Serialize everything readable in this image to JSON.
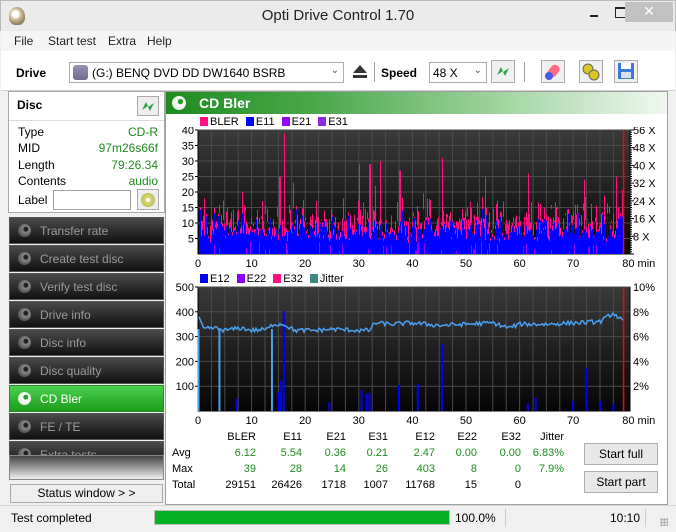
{
  "window": {
    "title": "Opti Drive Control 1.70",
    "close_glyph": "✕"
  },
  "menu": [
    "File",
    "Start test",
    "Extra",
    "Help"
  ],
  "toolbar": {
    "drive_label": "Drive",
    "drive_value": "(G:)   BENQ DVD DD DW1640 BSRB",
    "speed_label": "Speed",
    "speed_value": "48 X",
    "icons": [
      "eject-icon",
      "refresh-icon",
      "erase-icon",
      "settings-icon",
      "save-icon"
    ]
  },
  "disc": {
    "title": "Disc",
    "rows": [
      {
        "key": "Type",
        "value": "CD-R"
      },
      {
        "key": "MID",
        "value": "97m26s66f"
      },
      {
        "key": "Length",
        "value": "79:26.34"
      },
      {
        "key": "Contents",
        "value": "audio"
      }
    ],
    "label_key": "Label",
    "label_value": ""
  },
  "nav": [
    {
      "label": "Transfer rate",
      "active": false
    },
    {
      "label": "Create test disc",
      "active": false
    },
    {
      "label": "Verify test disc",
      "active": false
    },
    {
      "label": "Drive info",
      "active": false
    },
    {
      "label": "Disc info",
      "active": false
    },
    {
      "label": "Disc quality",
      "active": false
    },
    {
      "label": "CD Bler",
      "active": true
    },
    {
      "label": "FE / TE",
      "active": false
    },
    {
      "label": "Extra tests",
      "active": false
    }
  ],
  "status_window_button": "Status window > >",
  "main": {
    "title": "CD Bler",
    "colors": {
      "bler": "#ff1080",
      "e11": "#0000ff",
      "e21": "#9a00ff",
      "e31": "#8a2be2",
      "e12": "#0000ff",
      "e22": "#8a00ff",
      "e32": "#ff1080",
      "jitter": "#3a8a80",
      "jitter_line": "#4aa0f0",
      "marker": "#ff0000"
    }
  },
  "chart_data": [
    {
      "type": "bar",
      "title": "BLER / E11 / E21 / E31",
      "legend": [
        "BLER",
        "E11",
        "E21",
        "E31"
      ],
      "legend_placement": "top-left",
      "xlabel": "min",
      "x_ticks": [
        "0",
        "10",
        "20",
        "30",
        "40",
        "50",
        "60",
        "70",
        "80 min"
      ],
      "xlim": [
        0,
        80
      ],
      "y_ticks": [
        "5",
        "10",
        "15",
        "20",
        "25",
        "30",
        "35",
        "40"
      ],
      "ylim": [
        0,
        40
      ],
      "y2_ticks": [
        "8 X",
        "16 X",
        "24 X",
        "32 X",
        "40 X",
        "48 X",
        "56 X"
      ],
      "y2lim": [
        0,
        56
      ],
      "grid": true,
      "end_marker_min": 79.4,
      "series_summary": {
        "BLER": {
          "typical": 10,
          "max": 39,
          "peak_at_min": 16
        },
        "E11": {
          "typical": 8,
          "max": 28
        },
        "E21": {
          "typical": 0.4,
          "max": 14
        },
        "E31": {
          "typical": 0.2,
          "max": 26
        }
      },
      "peaks": [
        {
          "min": 1.2,
          "bler": 18
        },
        {
          "min": 8.2,
          "bler": 20
        },
        {
          "min": 12,
          "bler": 17
        },
        {
          "min": 15.2,
          "bler": 25
        },
        {
          "min": 16,
          "bler": 39
        },
        {
          "min": 17.8,
          "bler": 23
        },
        {
          "min": 22,
          "bler": 17
        },
        {
          "min": 27,
          "bler": 18
        },
        {
          "min": 30,
          "bler": 29
        },
        {
          "min": 32,
          "bler": 29
        },
        {
          "min": 33,
          "bler": 22
        },
        {
          "min": 34,
          "bler": 30
        },
        {
          "min": 37.5,
          "bler": 27
        },
        {
          "min": 45.5,
          "bler": 31
        },
        {
          "min": 53.5,
          "bler": 25
        },
        {
          "min": 61.5,
          "bler": 26
        },
        {
          "min": 72,
          "bler": 24
        },
        {
          "min": 78,
          "bler": 25
        }
      ]
    },
    {
      "type": "bar",
      "title": "E12 / E22 / E32 / Jitter",
      "legend": [
        "E12",
        "E22",
        "E32",
        "Jitter"
      ],
      "legend_placement": "top-left",
      "xlabel": "min",
      "x_ticks": [
        "0",
        "10",
        "20",
        "30",
        "40",
        "50",
        "60",
        "70",
        "80 min"
      ],
      "xlim": [
        0,
        80
      ],
      "y_ticks": [
        "100",
        "200",
        "300",
        "400",
        "500"
      ],
      "ylim": [
        0,
        500
      ],
      "y2_ticks": [
        "2%",
        "4%",
        "6%",
        "8%",
        "10%"
      ],
      "y2lim": [
        0,
        10
      ],
      "grid": true,
      "end_marker_min": 79.4,
      "e12_spikes": [
        {
          "min": 7.2,
          "value": 50
        },
        {
          "min": 15,
          "value": 75
        },
        {
          "min": 15.5,
          "value": 120
        },
        {
          "min": 16,
          "value": 403
        },
        {
          "min": 24.5,
          "value": 35
        },
        {
          "min": 30.5,
          "value": 85
        },
        {
          "min": 31.5,
          "value": 70
        },
        {
          "min": 32,
          "value": 72
        },
        {
          "min": 37.5,
          "value": 105
        },
        {
          "min": 41,
          "value": 110
        },
        {
          "min": 45.5,
          "value": 270
        },
        {
          "min": 61.5,
          "value": 30
        },
        {
          "min": 63,
          "value": 55
        },
        {
          "min": 70,
          "value": 40
        },
        {
          "min": 72.5,
          "value": 175
        },
        {
          "min": 75,
          "value": 40
        },
        {
          "min": 77.5,
          "value": 30
        }
      ],
      "jitter_points": [
        {
          "min": 0,
          "pct": 7.7
        },
        {
          "min": 1,
          "pct": 6.6
        },
        {
          "min": 3,
          "pct": 6.7
        },
        {
          "min": 5,
          "pct": 6.5
        },
        {
          "min": 8,
          "pct": 6.7
        },
        {
          "min": 10,
          "pct": 6.5
        },
        {
          "min": 13,
          "pct": 6.6
        },
        {
          "min": 14,
          "pct": 7.0
        },
        {
          "min": 16,
          "pct": 7.0
        },
        {
          "min": 18,
          "pct": 6.5
        },
        {
          "min": 22,
          "pct": 6.5
        },
        {
          "min": 25,
          "pct": 6.6
        },
        {
          "min": 30,
          "pct": 6.5
        },
        {
          "min": 32,
          "pct": 6.5
        },
        {
          "min": 33,
          "pct": 7.1
        },
        {
          "min": 36,
          "pct": 7.0
        },
        {
          "min": 40,
          "pct": 7.1
        },
        {
          "min": 45,
          "pct": 6.9
        },
        {
          "min": 50,
          "pct": 7.0
        },
        {
          "min": 55,
          "pct": 7.1
        },
        {
          "min": 58,
          "pct": 6.7
        },
        {
          "min": 60,
          "pct": 7.0
        },
        {
          "min": 65,
          "pct": 7.0
        },
        {
          "min": 70,
          "pct": 7.1
        },
        {
          "min": 75,
          "pct": 7.2
        },
        {
          "min": 77.5,
          "pct": 7.9
        },
        {
          "min": 79.4,
          "pct": 7.2
        }
      ],
      "jitter_dropouts_min": [
        0.1,
        4,
        13.8
      ]
    }
  ],
  "stats": {
    "columns": [
      "BLER",
      "E11",
      "E21",
      "E31",
      "E12",
      "E22",
      "E32",
      "Jitter"
    ],
    "rows": [
      {
        "label": "Avg",
        "values": [
          "6.12",
          "5.54",
          "0.36",
          "0.21",
          "2.47",
          "0.00",
          "0.00",
          "6.83%"
        ]
      },
      {
        "label": "Max",
        "values": [
          "39",
          "28",
          "14",
          "26",
          "403",
          "8",
          "0",
          "7.9%"
        ]
      },
      {
        "label": "Total",
        "values": [
          "29151",
          "26426",
          "1718",
          "1007",
          "11768",
          "15",
          "0",
          ""
        ]
      }
    ]
  },
  "buttons": {
    "start_full": "Start full",
    "start_part": "Start part"
  },
  "statusbar": {
    "status": "Test completed",
    "progress_pct": 100.0,
    "progress_text": "100.0%",
    "time": "10:10"
  }
}
